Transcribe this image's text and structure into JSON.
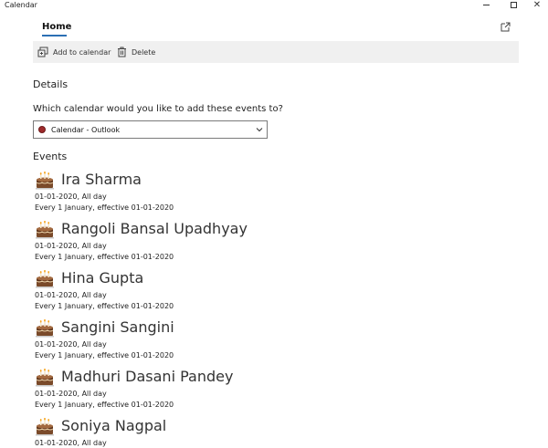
{
  "window": {
    "title": "Calendar",
    "minimize_icon": "minimize-icon",
    "maximize_icon": "maximize-icon",
    "close_icon": "close-icon"
  },
  "tabs": {
    "home": "Home"
  },
  "toolbar": {
    "add_label": "Add to calendar",
    "delete_label": "Delete"
  },
  "details": {
    "heading": "Details",
    "question": "Which calendar would you like to add these events to?",
    "selected_calendar": "Calendar - Outlook",
    "calendar_color": "#9e2a2b"
  },
  "events_heading": "Events",
  "events": [
    {
      "name": "Ira Sharma",
      "date": "01-01-2020, All day",
      "recurrence": "Every 1 January, effective 01-01-2020"
    },
    {
      "name": "Rangoli Bansal Upadhyay",
      "date": "01-01-2020, All day",
      "recurrence": "Every 1 January, effective 01-01-2020"
    },
    {
      "name": "Hina Gupta",
      "date": "01-01-2020, All day",
      "recurrence": "Every 1 January, effective 01-01-2020"
    },
    {
      "name": "Sangini Sangini",
      "date": "01-01-2020, All day",
      "recurrence": "Every 1 January, effective 01-01-2020"
    },
    {
      "name": "Madhuri Dasani Pandey",
      "date": "01-01-2020, All day",
      "recurrence": "Every 1 January, effective 01-01-2020"
    },
    {
      "name": "Soniya Nagpal",
      "date": "01-01-2020, All day",
      "recurrence": ""
    }
  ]
}
